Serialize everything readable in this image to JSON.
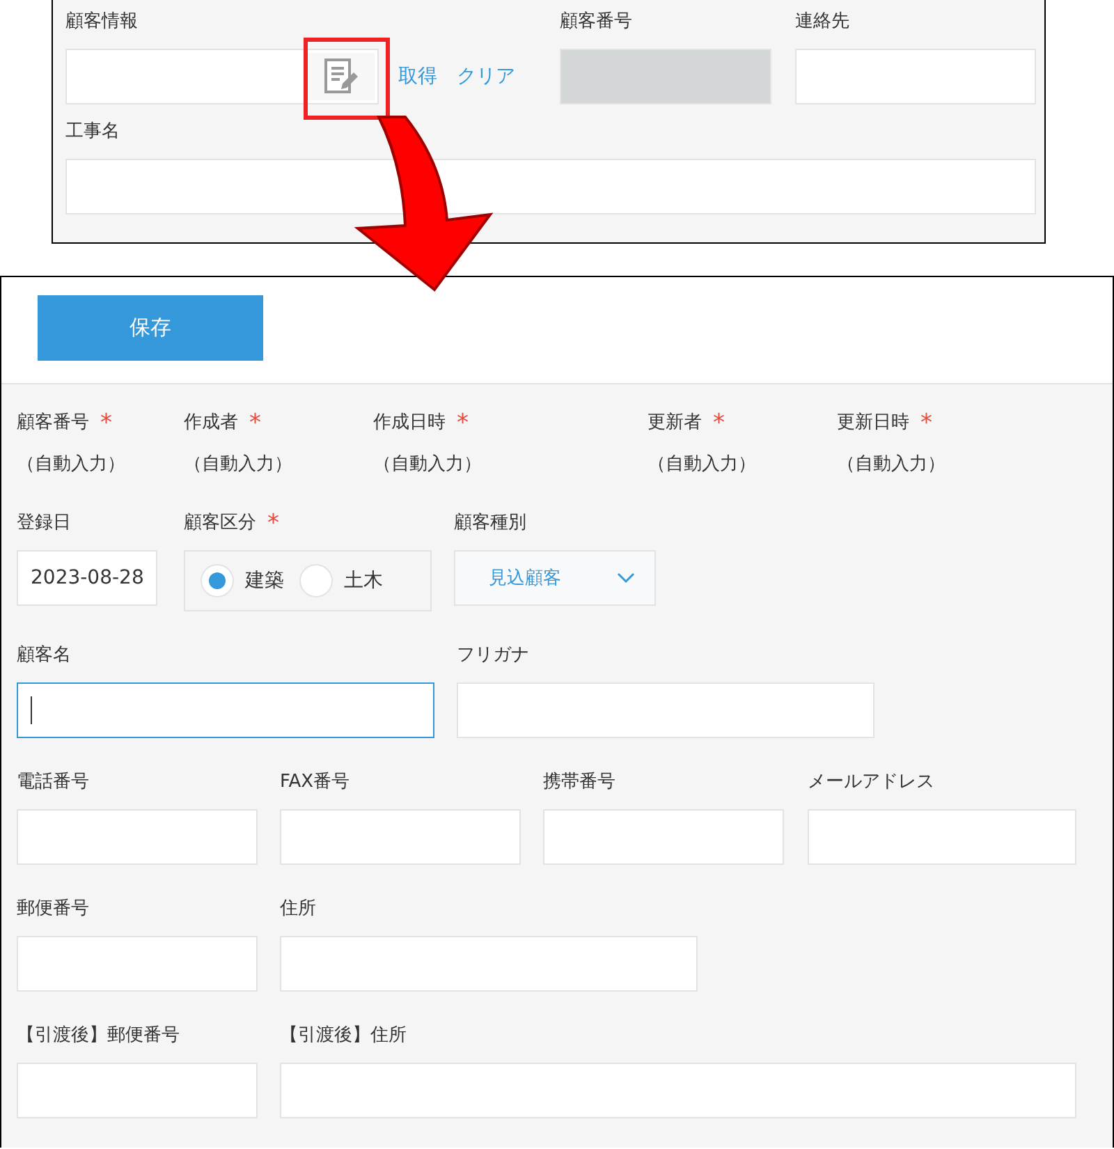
{
  "lookup_panel": {
    "rows": [
      {
        "fields": [
          {
            "kind": "lookup",
            "label": "顧客情報",
            "actions": [
              "取得",
              "クリア"
            ]
          },
          {
            "kind": "readonly",
            "label": "顧客番号"
          },
          {
            "kind": "text",
            "label": "連絡先"
          }
        ]
      },
      {
        "fields": [
          {
            "kind": "text",
            "label": "工事名"
          }
        ]
      }
    ]
  },
  "form": {
    "save_button": "保存",
    "rows": [
      {
        "fields": [
          {
            "kind": "auto",
            "label": "顧客番号",
            "required_mark": "*",
            "value": "（自動入力）"
          },
          {
            "kind": "auto",
            "label": "作成者",
            "required_mark": "*",
            "value": "（自動入力）"
          },
          {
            "kind": "auto",
            "label": "作成日時",
            "required_mark": "*",
            "value": "（自動入力）"
          },
          {
            "kind": "auto",
            "label": "更新者",
            "required_mark": "*",
            "value": "（自動入力）"
          },
          {
            "kind": "auto",
            "label": "更新日時",
            "required_mark": "*",
            "value": "（自動入力）"
          }
        ]
      },
      {
        "fields": [
          {
            "kind": "date",
            "label": "登録日",
            "value": "2023-08-28"
          },
          {
            "kind": "radio",
            "label": "顧客区分",
            "required_mark": "*",
            "options": [
              {
                "label": "建築",
                "selected": true
              },
              {
                "label": "土木",
                "selected": false
              }
            ]
          },
          {
            "kind": "dropdown",
            "label": "顧客種別",
            "value": "見込顧客"
          }
        ]
      },
      {
        "fields": [
          {
            "kind": "text",
            "label": "顧客名",
            "focused": true
          },
          {
            "kind": "text",
            "label": "フリガナ",
            "focused": false
          }
        ]
      },
      {
        "fields": [
          {
            "kind": "text",
            "label": "電話番号",
            "focused": false
          },
          {
            "kind": "text",
            "label": "FAX番号",
            "focused": false
          },
          {
            "kind": "text",
            "label": "携帯番号",
            "focused": false
          },
          {
            "kind": "text",
            "label": "メールアドレス",
            "focused": false
          }
        ]
      },
      {
        "fields": [
          {
            "kind": "text",
            "label": "郵便番号",
            "focused": false
          },
          {
            "kind": "text",
            "label": "住所",
            "focused": false
          }
        ]
      },
      {
        "fields": [
          {
            "kind": "text",
            "label": "【引渡後】郵便番号",
            "focused": false
          },
          {
            "kind": "text",
            "label": "【引渡後】住所",
            "focused": false
          }
        ]
      }
    ]
  }
}
